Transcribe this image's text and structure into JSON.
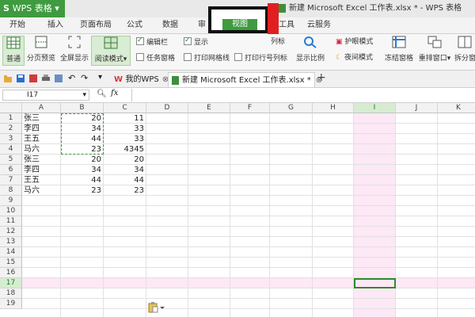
{
  "app": {
    "menu_button": "WPS 表格",
    "window_title": "新建 Microsoft Excel 工作表.xlsx * - WPS 表格"
  },
  "menu_tabs": [
    "开始",
    "插入",
    "页面布局",
    "公式",
    "数据",
    "审",
    "视图",
    "发工具",
    "云服务"
  ],
  "ribbon": {
    "normal": "普通",
    "page_break_preview": "分页预览",
    "full_screen": "全屏显示",
    "reading_mode": "阅读模式",
    "edit_bar": "编辑栏",
    "task_pane": "任务窗格",
    "show_grid": "显示",
    "print_gridlines": "打印网格线",
    "col_label": "列标",
    "print_row_col": "打印行号列标",
    "zoom_ratio": "显示比例",
    "eye_protection": "护眼模式",
    "night_mode": "夜间模式",
    "freeze_panes": "冻结窗格",
    "arrange_windows": "重排窗口",
    "split_window": "拆分窗"
  },
  "doc_tabs": {
    "wps": "我的WPS",
    "file": "新建 Microsoft Excel 工作表.xlsx *",
    "add": "+"
  },
  "formula_bar": {
    "cell_ref": "I17",
    "fx": "fx",
    "content": ""
  },
  "sheet": {
    "columns": [
      "A",
      "B",
      "C",
      "D",
      "E",
      "F",
      "G",
      "H",
      "I",
      "J",
      "K"
    ],
    "rows": [
      "1",
      "2",
      "3",
      "4",
      "5",
      "6",
      "7",
      "8",
      "9",
      "10",
      "11",
      "12",
      "13",
      "14",
      "15",
      "16",
      "17",
      "18",
      "19"
    ],
    "data": [
      [
        "张三",
        "20",
        "11"
      ],
      [
        "李四",
        "34",
        "33"
      ],
      [
        "王五",
        "44",
        "33"
      ],
      [
        "马六",
        "23",
        "4345"
      ],
      [
        "张三",
        "20",
        "20"
      ],
      [
        "李四",
        "34",
        "34"
      ],
      [
        "王五",
        "44",
        "44"
      ],
      [
        "马六",
        "23",
        "23"
      ]
    ],
    "selected_column": "I",
    "selected_row": "17"
  },
  "colors": {
    "accent": "#3f9b3f",
    "highlight_band": "#fde8f6",
    "red_mark": "#e02020"
  }
}
